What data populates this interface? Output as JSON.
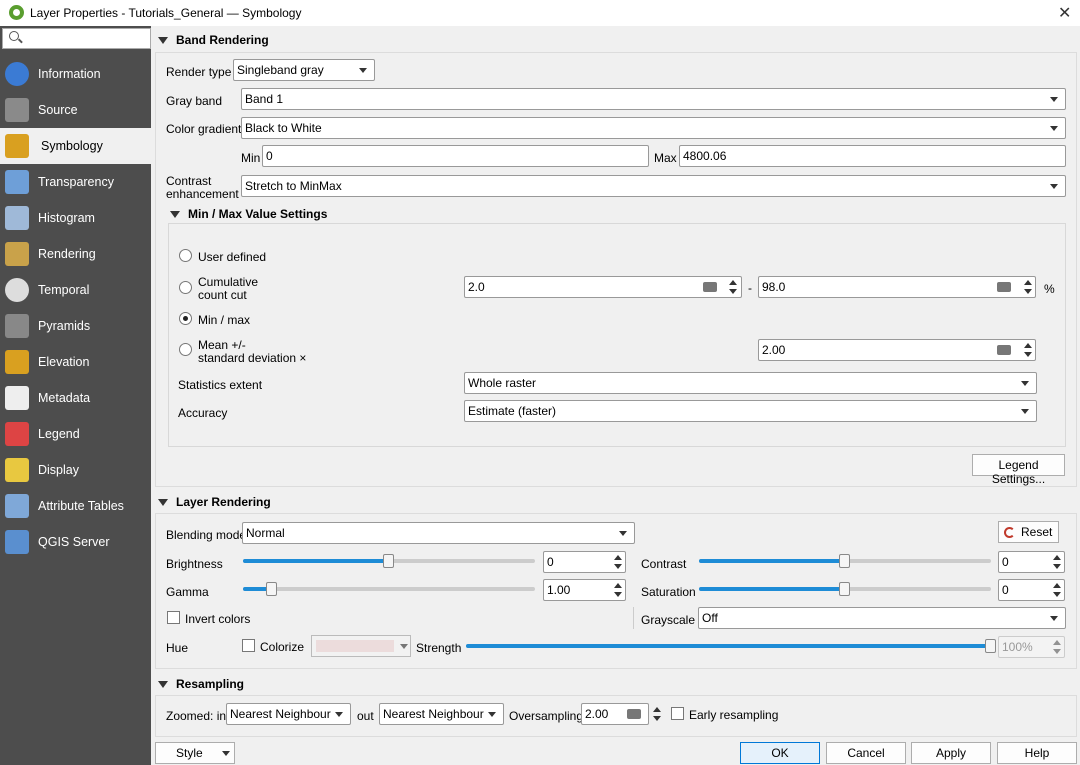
{
  "window": {
    "title": "Layer Properties - Tutorials_General — Symbology",
    "close_glyph": "✕"
  },
  "sidebar": {
    "items": [
      {
        "label": "Information",
        "icon": "information-icon"
      },
      {
        "label": "Source",
        "icon": "source-icon"
      },
      {
        "label": "Symbology",
        "icon": "symbology-icon"
      },
      {
        "label": "Transparency",
        "icon": "transparency-icon"
      },
      {
        "label": "Histogram",
        "icon": "histogram-icon"
      },
      {
        "label": "Rendering",
        "icon": "rendering-icon"
      },
      {
        "label": "Temporal",
        "icon": "temporal-icon"
      },
      {
        "label": "Pyramids",
        "icon": "pyramids-icon"
      },
      {
        "label": "Elevation",
        "icon": "elevation-icon"
      },
      {
        "label": "Metadata",
        "icon": "metadata-icon"
      },
      {
        "label": "Legend",
        "icon": "legend-icon"
      },
      {
        "label": "Display",
        "icon": "display-icon"
      },
      {
        "label": "Attribute Tables",
        "icon": "attribute-tables-icon"
      },
      {
        "label": "QGIS Server",
        "icon": "qgis-server-icon"
      }
    ]
  },
  "band": {
    "header": "Band Rendering",
    "render_type_label": "Render type",
    "render_type": "Singleband gray",
    "gray_band_label": "Gray band",
    "gray_band": "Band 1",
    "gradient_label": "Color gradient",
    "gradient": "Black to White",
    "min_label": "Min",
    "min": "0",
    "max_label": "Max",
    "max": "4800.06",
    "contrast_label1": "Contrast",
    "contrast_label2": "enhancement",
    "contrast": "Stretch to MinMax"
  },
  "minmax": {
    "header": "Min / Max Value Settings",
    "user_defined": "User defined",
    "cumulative1": "Cumulative",
    "cumulative2": "count cut",
    "cum_low": "2.0",
    "dash": "-",
    "cum_high": "98.0",
    "pct": "%",
    "minmax": "Min / max",
    "mean1": "Mean +/-",
    "mean2": "standard deviation ×",
    "stddev": "2.00",
    "stats_label": "Statistics extent",
    "stats": "Whole raster",
    "accuracy_label": "Accuracy",
    "accuracy": "Estimate (faster)",
    "legend_btn": "Legend Settings..."
  },
  "layer": {
    "header": "Layer Rendering",
    "blend_label": "Blending mode",
    "blend": "Normal",
    "reset": "Reset",
    "brightness_label": "Brightness",
    "brightness": "0",
    "brightness_level": 0.5,
    "contrast_label": "Contrast",
    "contrast": "0",
    "contrast_level": 0.5,
    "gamma_label": "Gamma",
    "gamma": "1.00",
    "gamma_level": 0.1,
    "saturation_label": "Saturation",
    "saturation": "0",
    "saturation_level": 0.5,
    "invert": "Invert colors",
    "grayscale_label": "Grayscale",
    "grayscale": "Off",
    "hue_label": "Hue",
    "colorize": "Colorize",
    "strength_label": "Strength",
    "strength": "100%",
    "strength_level": 1.0
  },
  "resampling": {
    "header": "Resampling",
    "zoom_in_label": "Zoomed: in",
    "zoom_in": "Nearest Neighbour",
    "out_label": "out",
    "zoom_out": "Nearest Neighbour",
    "oversampling_label": "Oversampling",
    "oversampling": "2.00",
    "early": "Early resampling"
  },
  "buttons": {
    "style": "Style",
    "ok": "OK",
    "cancel": "Cancel",
    "apply": "Apply",
    "help": "Help"
  }
}
